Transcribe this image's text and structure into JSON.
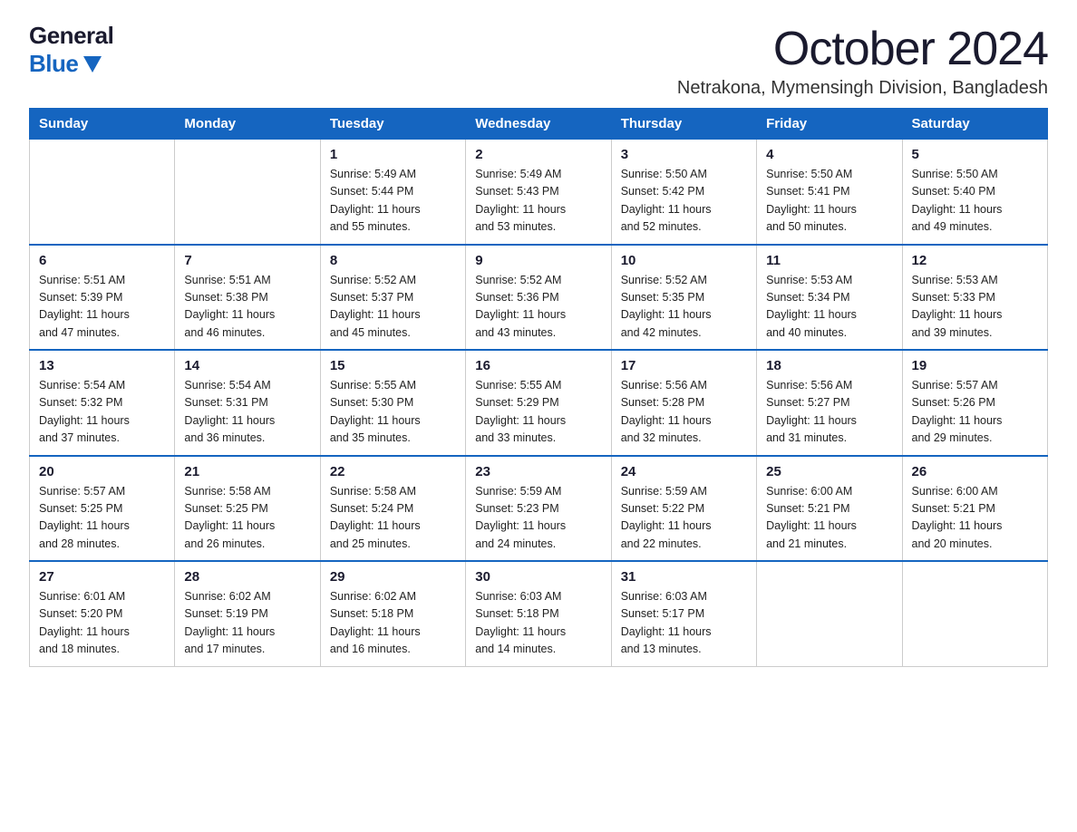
{
  "header": {
    "logo_general": "General",
    "logo_blue": "Blue",
    "month": "October 2024",
    "location": "Netrakona, Mymensingh Division, Bangladesh"
  },
  "weekdays": [
    "Sunday",
    "Monday",
    "Tuesday",
    "Wednesday",
    "Thursday",
    "Friday",
    "Saturday"
  ],
  "weeks": [
    [
      {
        "day": "",
        "info": ""
      },
      {
        "day": "",
        "info": ""
      },
      {
        "day": "1",
        "info": "Sunrise: 5:49 AM\nSunset: 5:44 PM\nDaylight: 11 hours\nand 55 minutes."
      },
      {
        "day": "2",
        "info": "Sunrise: 5:49 AM\nSunset: 5:43 PM\nDaylight: 11 hours\nand 53 minutes."
      },
      {
        "day": "3",
        "info": "Sunrise: 5:50 AM\nSunset: 5:42 PM\nDaylight: 11 hours\nand 52 minutes."
      },
      {
        "day": "4",
        "info": "Sunrise: 5:50 AM\nSunset: 5:41 PM\nDaylight: 11 hours\nand 50 minutes."
      },
      {
        "day": "5",
        "info": "Sunrise: 5:50 AM\nSunset: 5:40 PM\nDaylight: 11 hours\nand 49 minutes."
      }
    ],
    [
      {
        "day": "6",
        "info": "Sunrise: 5:51 AM\nSunset: 5:39 PM\nDaylight: 11 hours\nand 47 minutes."
      },
      {
        "day": "7",
        "info": "Sunrise: 5:51 AM\nSunset: 5:38 PM\nDaylight: 11 hours\nand 46 minutes."
      },
      {
        "day": "8",
        "info": "Sunrise: 5:52 AM\nSunset: 5:37 PM\nDaylight: 11 hours\nand 45 minutes."
      },
      {
        "day": "9",
        "info": "Sunrise: 5:52 AM\nSunset: 5:36 PM\nDaylight: 11 hours\nand 43 minutes."
      },
      {
        "day": "10",
        "info": "Sunrise: 5:52 AM\nSunset: 5:35 PM\nDaylight: 11 hours\nand 42 minutes."
      },
      {
        "day": "11",
        "info": "Sunrise: 5:53 AM\nSunset: 5:34 PM\nDaylight: 11 hours\nand 40 minutes."
      },
      {
        "day": "12",
        "info": "Sunrise: 5:53 AM\nSunset: 5:33 PM\nDaylight: 11 hours\nand 39 minutes."
      }
    ],
    [
      {
        "day": "13",
        "info": "Sunrise: 5:54 AM\nSunset: 5:32 PM\nDaylight: 11 hours\nand 37 minutes."
      },
      {
        "day": "14",
        "info": "Sunrise: 5:54 AM\nSunset: 5:31 PM\nDaylight: 11 hours\nand 36 minutes."
      },
      {
        "day": "15",
        "info": "Sunrise: 5:55 AM\nSunset: 5:30 PM\nDaylight: 11 hours\nand 35 minutes."
      },
      {
        "day": "16",
        "info": "Sunrise: 5:55 AM\nSunset: 5:29 PM\nDaylight: 11 hours\nand 33 minutes."
      },
      {
        "day": "17",
        "info": "Sunrise: 5:56 AM\nSunset: 5:28 PM\nDaylight: 11 hours\nand 32 minutes."
      },
      {
        "day": "18",
        "info": "Sunrise: 5:56 AM\nSunset: 5:27 PM\nDaylight: 11 hours\nand 31 minutes."
      },
      {
        "day": "19",
        "info": "Sunrise: 5:57 AM\nSunset: 5:26 PM\nDaylight: 11 hours\nand 29 minutes."
      }
    ],
    [
      {
        "day": "20",
        "info": "Sunrise: 5:57 AM\nSunset: 5:25 PM\nDaylight: 11 hours\nand 28 minutes."
      },
      {
        "day": "21",
        "info": "Sunrise: 5:58 AM\nSunset: 5:25 PM\nDaylight: 11 hours\nand 26 minutes."
      },
      {
        "day": "22",
        "info": "Sunrise: 5:58 AM\nSunset: 5:24 PM\nDaylight: 11 hours\nand 25 minutes."
      },
      {
        "day": "23",
        "info": "Sunrise: 5:59 AM\nSunset: 5:23 PM\nDaylight: 11 hours\nand 24 minutes."
      },
      {
        "day": "24",
        "info": "Sunrise: 5:59 AM\nSunset: 5:22 PM\nDaylight: 11 hours\nand 22 minutes."
      },
      {
        "day": "25",
        "info": "Sunrise: 6:00 AM\nSunset: 5:21 PM\nDaylight: 11 hours\nand 21 minutes."
      },
      {
        "day": "26",
        "info": "Sunrise: 6:00 AM\nSunset: 5:21 PM\nDaylight: 11 hours\nand 20 minutes."
      }
    ],
    [
      {
        "day": "27",
        "info": "Sunrise: 6:01 AM\nSunset: 5:20 PM\nDaylight: 11 hours\nand 18 minutes."
      },
      {
        "day": "28",
        "info": "Sunrise: 6:02 AM\nSunset: 5:19 PM\nDaylight: 11 hours\nand 17 minutes."
      },
      {
        "day": "29",
        "info": "Sunrise: 6:02 AM\nSunset: 5:18 PM\nDaylight: 11 hours\nand 16 minutes."
      },
      {
        "day": "30",
        "info": "Sunrise: 6:03 AM\nSunset: 5:18 PM\nDaylight: 11 hours\nand 14 minutes."
      },
      {
        "day": "31",
        "info": "Sunrise: 6:03 AM\nSunset: 5:17 PM\nDaylight: 11 hours\nand 13 minutes."
      },
      {
        "day": "",
        "info": ""
      },
      {
        "day": "",
        "info": ""
      }
    ]
  ]
}
